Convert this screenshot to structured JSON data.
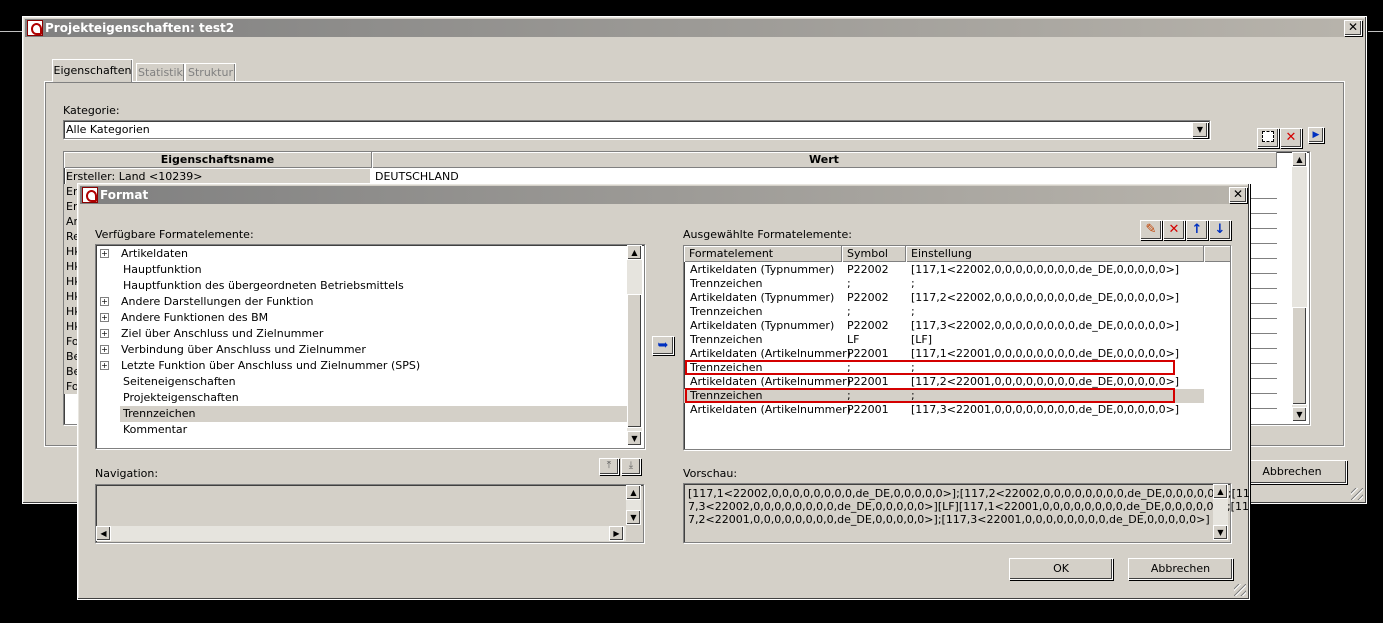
{
  "main_window": {
    "title": "Projekteigenschaften: test2",
    "close_symbol": "✕",
    "tabs": [
      {
        "label": "Eigenschaften",
        "active": true
      },
      {
        "label": "Statistik",
        "active": false
      },
      {
        "label": "Struktur",
        "active": false
      }
    ],
    "kategorie_label": "Kategorie:",
    "kategorie_value": "Alle Kategorien",
    "table_headers": [
      "Eigenschaftsname",
      "Wert"
    ],
    "first_row": {
      "name": "Ersteller: Land <10239>",
      "value": "DEUTSCHLAND"
    },
    "row_prefixes": [
      "Er",
      "Er",
      "Ar",
      "Re",
      "Hk",
      "Hk",
      "Hk",
      "Hk",
      "Hk",
      "Hk",
      "Fo",
      "Be",
      "Be",
      "Fo"
    ],
    "abbrechen_label": "Abbrechen"
  },
  "format_dialog": {
    "title": "Format",
    "close_symbol": "✕",
    "available_label": "Verfügbare Formatelemente:",
    "available_items": [
      {
        "label": "Artikeldaten",
        "expandable": true
      },
      {
        "label": "Hauptfunktion",
        "expandable": false
      },
      {
        "label": "Hauptfunktion des übergeordneten Betriebsmittels",
        "expandable": false
      },
      {
        "label": "Andere Darstellungen der Funktion",
        "expandable": true
      },
      {
        "label": "Andere Funktionen des BM",
        "expandable": true
      },
      {
        "label": "Ziel über Anschluss und Zielnummer",
        "expandable": true
      },
      {
        "label": "Verbindung über Anschluss und Zielnummer",
        "expandable": true
      },
      {
        "label": "Letzte Funktion über Anschluss und Zielnummer (SPS)",
        "expandable": true
      },
      {
        "label": "Seiteneigenschaften",
        "expandable": false
      },
      {
        "label": "Projekteigenschaften",
        "expandable": false
      },
      {
        "label": "Trennzeichen",
        "expandable": false,
        "selected": true
      },
      {
        "label": "Kommentar",
        "expandable": false
      }
    ],
    "selected_label": "Ausgewählte Formatelemente:",
    "selected_headers": [
      "Formatelement",
      "Symbol",
      "Einstellung"
    ],
    "selected_rows": [
      {
        "element": "Artikeldaten (Typnummer)",
        "symbol": "P22002",
        "setting": "[117,1<22002,0,0,0,0,0,0,0,0,de_DE,0,0,0,0,0>]"
      },
      {
        "element": "Trennzeichen",
        "symbol": ";",
        "setting": ";"
      },
      {
        "element": "Artikeldaten (Typnummer)",
        "symbol": "P22002",
        "setting": "[117,2<22002,0,0,0,0,0,0,0,0,de_DE,0,0,0,0,0>]"
      },
      {
        "element": "Trennzeichen",
        "symbol": ";",
        "setting": ";"
      },
      {
        "element": "Artikeldaten (Typnummer)",
        "symbol": "P22002",
        "setting": "[117,3<22002,0,0,0,0,0,0,0,0,de_DE,0,0,0,0,0>]"
      },
      {
        "element": "Trennzeichen",
        "symbol": "LF",
        "setting": "[LF]"
      },
      {
        "element": "Artikeldaten (Artikelnummer)",
        "symbol": "P22001",
        "setting": "[117,1<22001,0,0,0,0,0,0,0,0,de_DE,0,0,0,0,0>]"
      },
      {
        "element": "Trennzeichen",
        "symbol": ";",
        "setting": ";",
        "highlighted": true
      },
      {
        "element": "Artikeldaten (Artikelnummer)",
        "symbol": "P22001",
        "setting": "[117,2<22001,0,0,0,0,0,0,0,0,de_DE,0,0,0,0,0>]"
      },
      {
        "element": "Trennzeichen",
        "symbol": ";",
        "setting": ";",
        "highlighted": true,
        "selected": true
      },
      {
        "element": "Artikeldaten (Artikelnummer)",
        "symbol": "P22001",
        "setting": "[117,3<22001,0,0,0,0,0,0,0,0,de_DE,0,0,0,0,0>]"
      }
    ],
    "navigation_label": "Navigation:",
    "vorschau_label": "Vorschau:",
    "vorschau_lines": [
      "[117,1<22002,0,0,0,0,0,0,0,0,de_DE,0,0,0,0,0>];[117,2<22002,0,0,0,0,0,0,0,0,de_DE,0,0,0,0,0>];[11",
      "7,3<22002,0,0,0,0,0,0,0,0,de_DE,0,0,0,0,0>][LF][117,1<22001,0,0,0,0,0,0,0,0,de_DE,0,0,0,0,0>];[11",
      "7,2<22001,0,0,0,0,0,0,0,0,de_DE,0,0,0,0,0>];[117,3<22001,0,0,0,0,0,0,0,0,de_DE,0,0,0,0,0>]"
    ],
    "ok_label": "OK",
    "abbrechen_label": "Abbrechen",
    "highlight_color": "#d40000"
  }
}
